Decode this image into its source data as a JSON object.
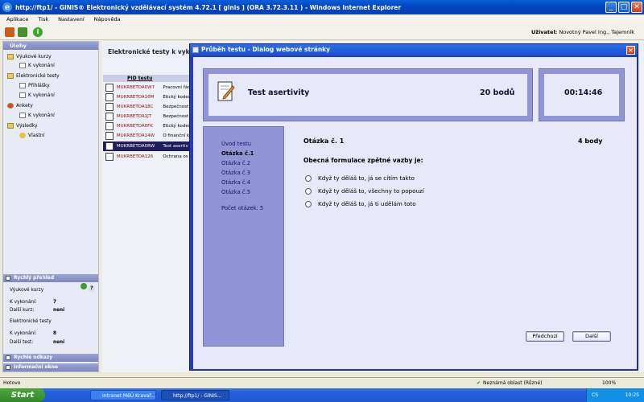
{
  "window": {
    "title": "http://ftp1/ - GINIS® Elektronický vzdělávací systém 4.72.1 [ ginis ] (ORA 3.72.3.11 ) - Windows Internet Explorer",
    "buttons": [
      "_",
      "□",
      "✕"
    ]
  },
  "menu": [
    "Aplikace",
    "Tisk",
    "Nastavení",
    "Nápověda"
  ],
  "user": {
    "label": "Uživatel:",
    "name": "Novotný Pavel Ing., Tajemník"
  },
  "sidebar": {
    "header": "Úlohy",
    "tree": [
      {
        "label": "Výukové kurzy",
        "level": 0
      },
      {
        "label": "K vykonání",
        "level": 1
      },
      {
        "label": "Elektronické testy",
        "level": 0
      },
      {
        "label": "Přihlášky",
        "level": 1
      },
      {
        "label": "K vykonání",
        "level": 1
      },
      {
        "label": "Ankety",
        "level": 0
      },
      {
        "label": "K vykonání",
        "level": 1
      },
      {
        "label": "Výsledky",
        "level": 0
      },
      {
        "label": "Vlastní",
        "level": 1
      }
    ],
    "quick": {
      "header": "Rychlý přehled",
      "courses_label": "Výukové kurzy",
      "courses_todo_label": "K vykonání:",
      "courses_todo_value": "7",
      "courses_next_label": "Další kurz:",
      "courses_next_value": "není",
      "tests_label": "Elektronické testy",
      "tests_todo_label": "K vykonání:",
      "tests_todo_value": "8",
      "tests_next_label": "Další test:",
      "tests_next_value": "není"
    },
    "links_header": "Rychlé odkazy",
    "info_header": "Informační okno"
  },
  "main": {
    "title": "Elektronické testy k vykonání",
    "column_pid": "PID testu",
    "rows": [
      {
        "pid": "MUKRBETDA0W7",
        "name": "Pracovní řád"
      },
      {
        "pid": "MUKRBETDA16M",
        "name": "Etický kodex"
      },
      {
        "pid": "MUKRBETDA18C",
        "name": "Bezpečnost"
      },
      {
        "pid": "MUKRBETDA1JT",
        "name": "Bezpečnost"
      },
      {
        "pid": "MUKRBETDA0FK",
        "name": "Etický kodex"
      },
      {
        "pid": "MUKRBETDA14W",
        "name": "O finanční k"
      },
      {
        "pid": "MUKRBETDA0RW",
        "name": "Test asertiv",
        "selected": true
      },
      {
        "pid": "MUKRBETDA126",
        "name": "Ochrana os"
      }
    ]
  },
  "dialog": {
    "title": "Průběh testu - Dialog webové stránky",
    "test_name": "Test asertivity",
    "total_points": "20 bodů",
    "timer": "00:14:46",
    "nav": {
      "intro": "Úvod testu",
      "questions": [
        "Otázka č.1",
        "Otázka č.2",
        "Otázka č.3",
        "Otázka č.4",
        "Otázka č.5"
      ],
      "count_label": "Počet otázek: 5"
    },
    "question": {
      "title": "Otázka č. 1",
      "points": "4 body",
      "text": "Obecná formulace zpětné vazby je:",
      "options": [
        "Když ty děláš to, já se cítím takto",
        "Když ty děláš to, všechny to popouzí",
        "Když ty děláš to, já ti udělám toto"
      ]
    },
    "buttons": {
      "prev": "Předchozí",
      "next": "Další"
    }
  },
  "statusbar": {
    "left": "Hotovo",
    "zone": "Neznámá oblast (Různé)",
    "zoom": "100%"
  },
  "taskbar": {
    "start": "Start",
    "tasks": [
      "Intranet MěÚ Kravař...",
      "http://ftp1/ - GINIS..."
    ],
    "lang": "CS",
    "clock": "10:25"
  },
  "colors": {
    "dialog_frame": "#2a3bb8",
    "panel_purple": "#8f95d5",
    "selected_row": "#1c1d5a"
  }
}
